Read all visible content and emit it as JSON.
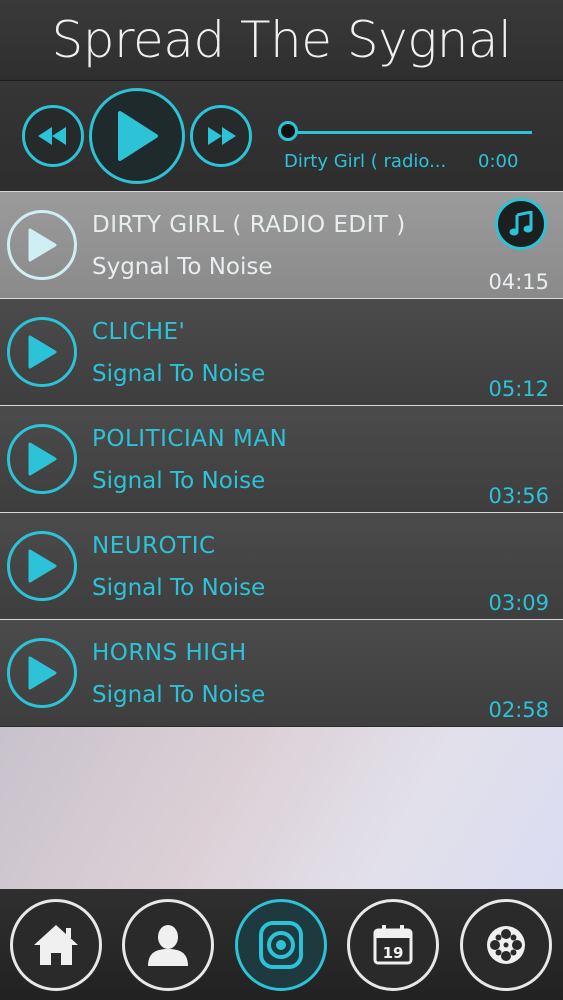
{
  "app": {
    "title": "Spread The Sygnal"
  },
  "player": {
    "now_playing": "Dirty Girl ( radio...",
    "time": "0:00",
    "progress": 0
  },
  "tracks": [
    {
      "title": "DIRTY GIRL ( RADIO EDIT )",
      "artist": "Sygnal To Noise",
      "duration": "04:15",
      "active": true
    },
    {
      "title": "CLICHE'",
      "artist": "Signal To Noise",
      "duration": "05:12",
      "active": false
    },
    {
      "title": "POLITICIAN MAN",
      "artist": "Signal To Noise",
      "duration": "03:56",
      "active": false
    },
    {
      "title": "NEUROTIC",
      "artist": "Signal To Noise",
      "duration": "03:09",
      "active": false
    },
    {
      "title": "HORNS HIGH",
      "artist": "Signal To Noise",
      "duration": "02:58",
      "active": false
    }
  ],
  "tabs": [
    {
      "icon": "home-icon"
    },
    {
      "icon": "user-icon"
    },
    {
      "icon": "speaker-icon",
      "active": true
    },
    {
      "icon": "calendar-icon",
      "calendar_day": "19"
    },
    {
      "icon": "film-reel-icon"
    }
  ],
  "colors": {
    "accent": "#2cc3d8",
    "active_row": "#939393",
    "row": "#454545"
  }
}
